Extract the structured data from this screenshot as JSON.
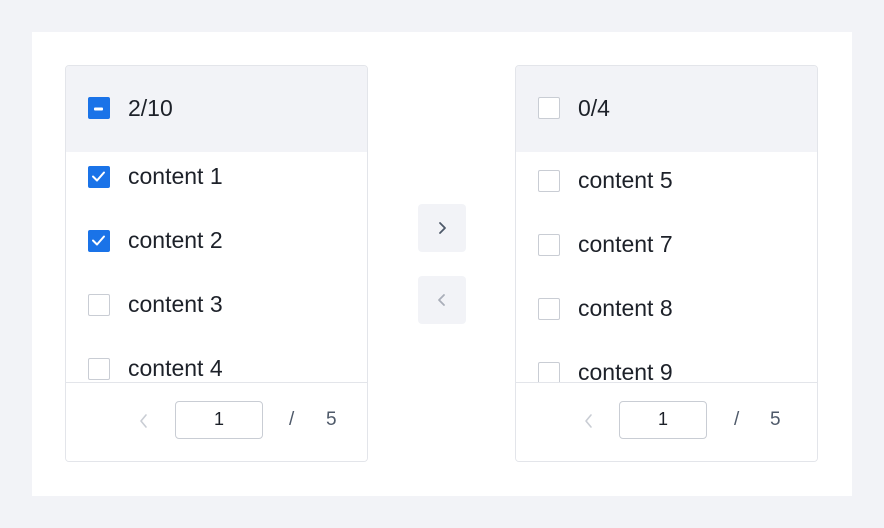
{
  "colors": {
    "accent": "#1a73e8",
    "border": "#e3e5ea",
    "header_bg": "#f2f3f7"
  },
  "left_panel": {
    "count": "2/10",
    "header_state": "indeterminate",
    "items": [
      {
        "label": "content 1",
        "checked": true
      },
      {
        "label": "content 2",
        "checked": true
      },
      {
        "label": "content 3",
        "checked": false
      },
      {
        "label": "content 4",
        "checked": false
      }
    ],
    "pagination": {
      "current": "1",
      "separator": "/",
      "total": "5"
    }
  },
  "right_panel": {
    "count": "0/4",
    "header_state": "unchecked",
    "items": [
      {
        "label": "content 5",
        "checked": false
      },
      {
        "label": "content 7",
        "checked": false
      },
      {
        "label": "content 8",
        "checked": false
      },
      {
        "label": "content 9",
        "checked": false
      }
    ],
    "pagination": {
      "current": "1",
      "separator": "/",
      "total": "5"
    }
  },
  "actions": {
    "move_right_icon": "chevron-right-icon",
    "move_left_icon": "chevron-left-icon"
  }
}
